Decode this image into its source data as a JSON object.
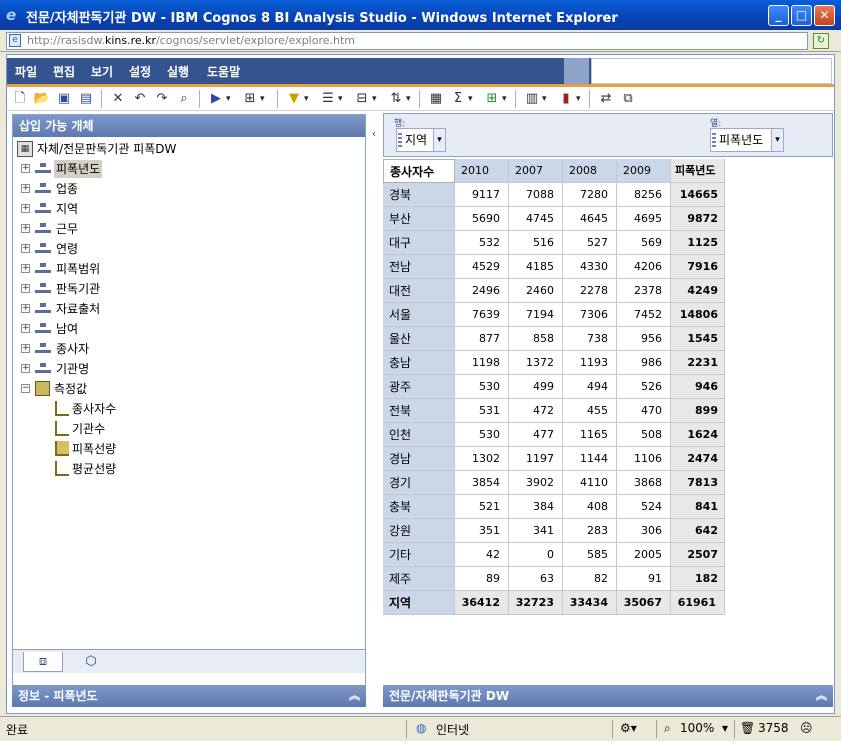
{
  "window": {
    "title": "전문/자체판독기관 DW - IBM Cognos 8 BI Analysis Studio - Windows Internet Explorer",
    "address_domain_prefix": "http://rasisdw.",
    "address_domain": "kins.re.kr",
    "address_path": "/cognos/servlet/explore/explore.htm"
  },
  "menubar": {
    "items": [
      "파일",
      "편집",
      "보기",
      "설정",
      "실행",
      "도움말"
    ]
  },
  "left_panel": {
    "header": "삽입 가능 개체",
    "root": "자체/전문판독기관 피폭DW",
    "dimensions": [
      "피폭년도",
      "업종",
      "지역",
      "근무",
      "연령",
      "피폭범위",
      "판독기관",
      "자료출처",
      "남여",
      "종사자",
      "기관명"
    ],
    "measures_folder": "측정값",
    "measures": [
      "종사자수",
      "기관수",
      "피폭선량",
      "평균선량"
    ]
  },
  "info_panel": {
    "title": "정보 - 피폭년도"
  },
  "dropzones": {
    "rows_label": "행:",
    "rows_value": "지역",
    "cols_label": "열:",
    "cols_value": "피폭년도"
  },
  "crosstab": {
    "corner": "종사자수",
    "columns": [
      "2010",
      "2007",
      "2008",
      "2009"
    ],
    "total_header": "피폭년도",
    "rows": [
      {
        "label": "경북",
        "values": [
          "9117",
          "7088",
          "7280",
          "8256"
        ],
        "total": "14665"
      },
      {
        "label": "부산",
        "values": [
          "5690",
          "4745",
          "4645",
          "4695"
        ],
        "total": "9872"
      },
      {
        "label": "대구",
        "values": [
          "532",
          "516",
          "527",
          "569"
        ],
        "total": "1125"
      },
      {
        "label": "전남",
        "values": [
          "4529",
          "4185",
          "4330",
          "4206"
        ],
        "total": "7916"
      },
      {
        "label": "대전",
        "values": [
          "2496",
          "2460",
          "2278",
          "2378"
        ],
        "total": "4249"
      },
      {
        "label": "서울",
        "values": [
          "7639",
          "7194",
          "7306",
          "7452"
        ],
        "total": "14806"
      },
      {
        "label": "울산",
        "values": [
          "877",
          "858",
          "738",
          "956"
        ],
        "total": "1545"
      },
      {
        "label": "충남",
        "values": [
          "1198",
          "1372",
          "1193",
          "986"
        ],
        "total": "2231"
      },
      {
        "label": "광주",
        "values": [
          "530",
          "499",
          "494",
          "526"
        ],
        "total": "946"
      },
      {
        "label": "전북",
        "values": [
          "531",
          "472",
          "455",
          "470"
        ],
        "total": "899"
      },
      {
        "label": "인천",
        "values": [
          "530",
          "477",
          "1165",
          "508"
        ],
        "total": "1624"
      },
      {
        "label": "경남",
        "values": [
          "1302",
          "1197",
          "1144",
          "1106"
        ],
        "total": "2474"
      },
      {
        "label": "경기",
        "values": [
          "3854",
          "3902",
          "4110",
          "3868"
        ],
        "total": "7813"
      },
      {
        "label": "충북",
        "values": [
          "521",
          "384",
          "408",
          "524"
        ],
        "total": "841"
      },
      {
        "label": "강원",
        "values": [
          "351",
          "341",
          "283",
          "306"
        ],
        "total": "642"
      },
      {
        "label": "기타",
        "values": [
          "42",
          "0",
          "585",
          "2005"
        ],
        "total": "2507"
      },
      {
        "label": "제주",
        "values": [
          "89",
          "63",
          "82",
          "91"
        ],
        "total": "182"
      }
    ],
    "footer_label": "지역",
    "footer_values": [
      "36412",
      "32723",
      "33434",
      "35067"
    ],
    "footer_total": "61961"
  },
  "right_footer": {
    "title": "전문/자체판독기관 DW"
  },
  "statusbar": {
    "status": "완료",
    "zone": "인터넷",
    "zoom": "100%",
    "count": "3758"
  }
}
